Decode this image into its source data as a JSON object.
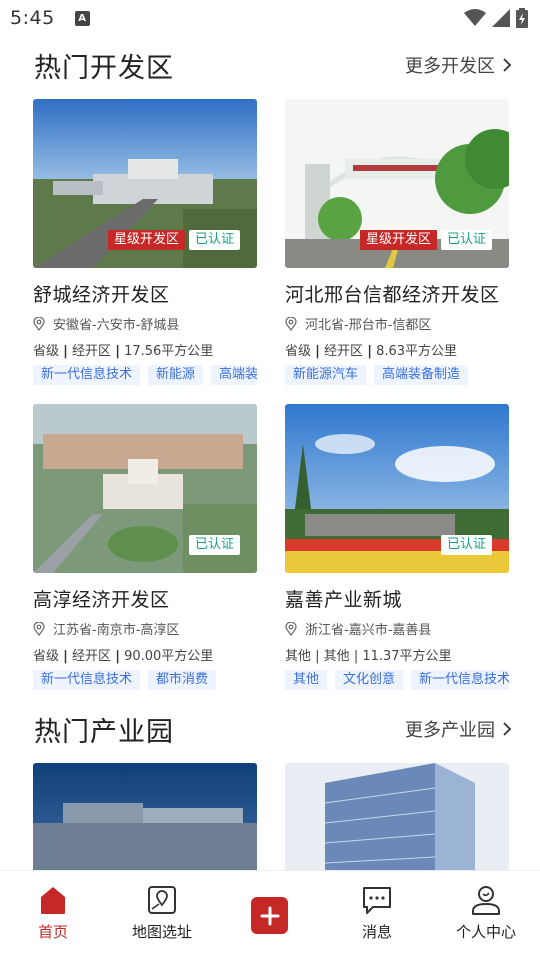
{
  "status_bar": {
    "time": "5:45"
  },
  "dev_zones": {
    "title": "热门开发区",
    "more_label": "更多开发区",
    "cards": [
      {
        "name": "舒城经济开发区",
        "level_badge": "星级开发区",
        "cert_badge": "已认证",
        "location": "安徽省-六安市-舒城县",
        "type1": "省级",
        "type2": "经开区",
        "area": "17.56平方公里",
        "tags": [
          "新一代信息技术",
          "新能源",
          "高端装"
        ]
      },
      {
        "name": "河北邢台信都经济开发区",
        "level_badge": "星级开发区",
        "cert_badge": "已认证",
        "location": "河北省-邢台市-信都区",
        "type1": "省级",
        "type2": "经开区",
        "area": "8.63平方公里",
        "tags": [
          "新能源汽车",
          "高端装备制造"
        ]
      },
      {
        "name": "高淳经济开发区",
        "cert_badge": "已认证",
        "location": "江苏省-南京市-高淳区",
        "type1": "省级",
        "type2": "经开区",
        "area": "90.00平方公里",
        "tags": [
          "新一代信息技术",
          "都市消费"
        ]
      },
      {
        "name": "嘉善产业新城",
        "cert_badge": "已认证",
        "location": "浙江省-嘉兴市-嘉善县",
        "type1": "其他",
        "type2": "其他",
        "area": "11.37平方公里",
        "tags": [
          "其他",
          "文化创意",
          "新一代信息技术"
        ]
      }
    ]
  },
  "parks": {
    "title": "热门产业园",
    "more_label": "更多产业园"
  },
  "bottom_nav": {
    "home": "首页",
    "map": "地图选址",
    "messages": "消息",
    "profile": "个人中心"
  },
  "colors": {
    "brand_red": "#c62828",
    "cert_green": "#1aa088",
    "tag_blue": "#3b6fd8"
  }
}
